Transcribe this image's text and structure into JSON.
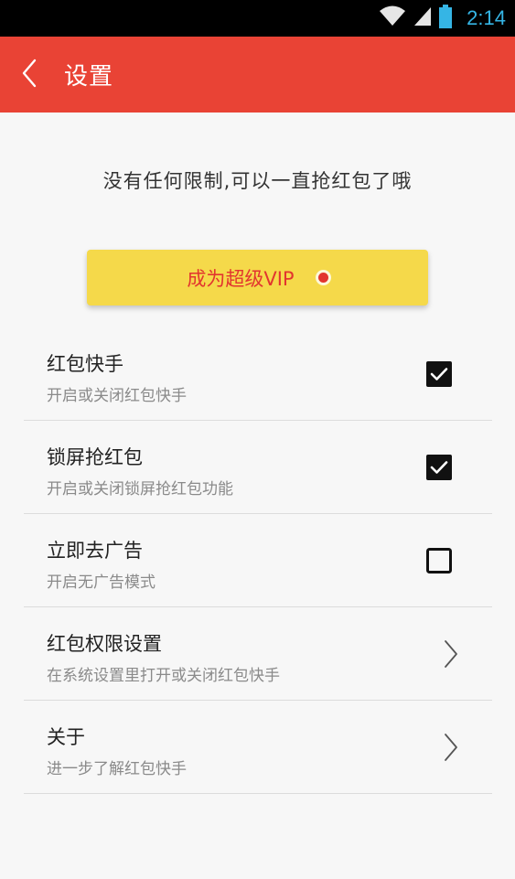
{
  "status_bar": {
    "time": "2:14",
    "icons": [
      "wifi-icon",
      "cellular-signal-icon",
      "battery-icon"
    ]
  },
  "app_bar": {
    "back_icon": "chevron-left-icon",
    "title": "设置"
  },
  "tagline": "没有任何限制,可以一直抢红包了哦",
  "vip": {
    "label": "成为超级VIP",
    "dot_icon": "red-dot-icon"
  },
  "settings": [
    {
      "title": "红包快手",
      "subtitle": "开启或关闭红包快手",
      "control": "checkbox",
      "checked": true
    },
    {
      "title": "锁屏抢红包",
      "subtitle": "开启或关闭锁屏抢红包功能",
      "control": "checkbox",
      "checked": true
    },
    {
      "title": "立即去广告",
      "subtitle": "开启无广告模式",
      "control": "checkbox",
      "checked": false
    },
    {
      "title": "红包权限设置",
      "subtitle": "在系统设置里打开或关闭红包快手",
      "control": "chevron",
      "checked": false
    },
    {
      "title": "关于",
      "subtitle": "进一步了解红包快手",
      "control": "chevron",
      "checked": false
    }
  ],
  "colors": {
    "app_bar": "#e94335",
    "vip_button": "#f5d94a",
    "vip_text": "#e2352f",
    "status_time": "#35b5e5"
  }
}
